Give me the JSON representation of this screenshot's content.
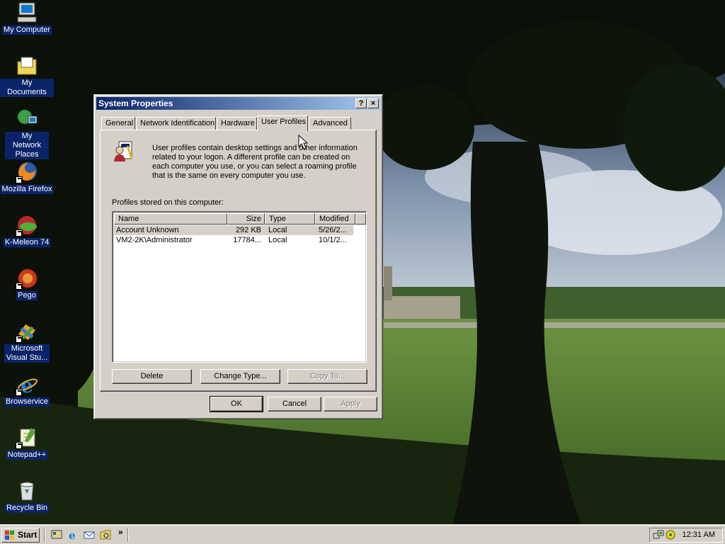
{
  "desktop": {
    "icons": [
      {
        "label": "My Computer",
        "icon": "my-computer-icon"
      },
      {
        "label": "My Documents",
        "icon": "folder-icon"
      },
      {
        "label": "My Network Places",
        "icon": "network-places-icon"
      },
      {
        "label": "Mozilla Firefox",
        "icon": "firefox-icon"
      },
      {
        "label": "K-Meleon 74",
        "icon": "k-meleon-icon"
      },
      {
        "label": "Pego",
        "icon": "pego-icon"
      },
      {
        "label": "Microsoft Visual Stu...",
        "icon": "visual-studio-icon"
      },
      {
        "label": "Browservice",
        "icon": "internet-explorer-icon"
      },
      {
        "label": "Notepad++",
        "icon": "notepad-plus-plus-icon"
      },
      {
        "label": "Recycle Bin",
        "icon": "recycle-bin-icon"
      }
    ]
  },
  "window": {
    "title": "System Properties",
    "help_label": "?",
    "close_label": "×",
    "tabs": [
      {
        "label": "General"
      },
      {
        "label": "Network Identification"
      },
      {
        "label": "Hardware"
      },
      {
        "label": "User Profiles"
      },
      {
        "label": "Advanced"
      }
    ],
    "active_tab": "User Profiles",
    "intro": "User profiles contain desktop settings and other information related to your logon.  A different profile can be created on each computer you use, or you can select a roaming profile that is the same on every computer you use.",
    "profiles_label": "Profiles stored on this computer:",
    "columns": [
      "Name",
      "Size",
      "Type",
      "Modified"
    ],
    "profiles": [
      {
        "name": "Account Unknown",
        "size": "292 KB",
        "type": "Local",
        "modified": "5/26/2...",
        "selected": true
      },
      {
        "name": "VM2-2K\\Administrator",
        "size": "17784...",
        "type": "Local",
        "modified": "10/1/2...",
        "selected": false
      }
    ],
    "buttons": {
      "delete": "Delete",
      "change_type": "Change Type...",
      "copy_to": "Copy To...",
      "ok": "OK",
      "cancel": "Cancel",
      "apply": "Apply"
    }
  },
  "taskbar": {
    "start_label": "Start",
    "quick_launch": [
      "show-desktop-icon",
      "internet-explorer-icon",
      "outlook-express-icon",
      "windows-explorer-icon"
    ],
    "chevron": "»",
    "clock": "12:31 AM"
  },
  "colors": {
    "selection": "#0a246a",
    "face": "#d4d0c8",
    "title_start": "#0a246a",
    "title_end": "#a6caf0"
  }
}
